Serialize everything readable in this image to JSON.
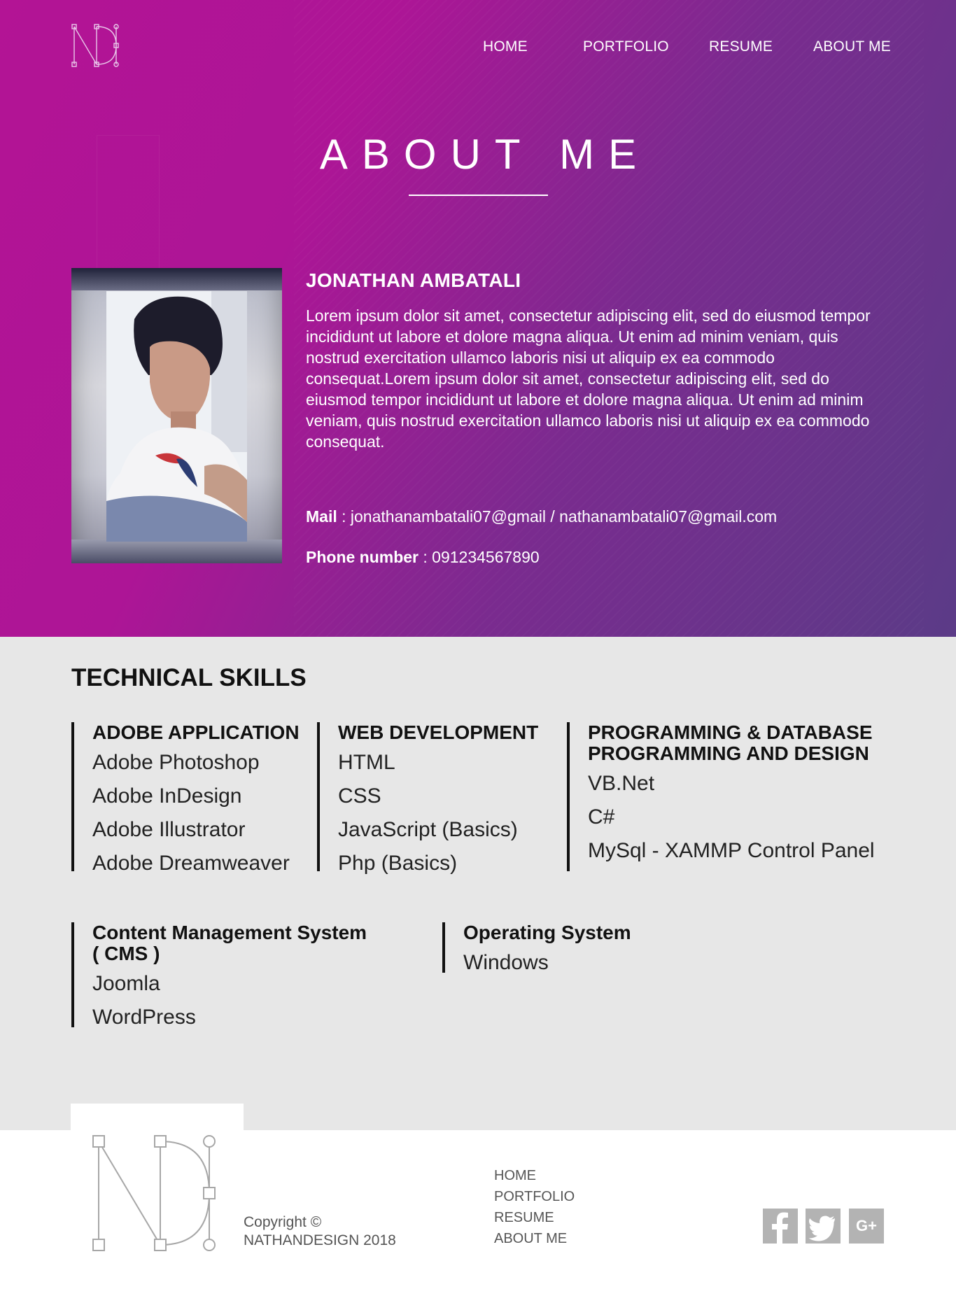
{
  "nav": {
    "items": [
      "HOME",
      "PORTFOLIO",
      "RESUME",
      "ABOUT ME"
    ]
  },
  "hero": {
    "title": "ABOUT ME",
    "name": "JONATHAN AMBATALI",
    "bio": "Lorem ipsum dolor sit amet, consectetur adipiscing elit, sed do eiusmod tempor incididunt ut labore et dolore magna aliqua. Ut enim ad minim veniam, quis nostrud exercitation ullamco laboris nisi ut aliquip ex ea commodo consequat.Lorem ipsum dolor sit amet, consectetur adipiscing elit, sed do eiusmod tempor incididunt ut labore et dolore magna aliqua. Ut enim ad minim veniam, quis nostrud exercitation ullamco laboris nisi ut aliquip ex ea commodo consequat.",
    "mail_label": "Mail",
    "mail_value": " : jonathanambatali07@gmail / nathanambatali07@gmail.com",
    "phone_label": "Phone number",
    "phone_value": " : 091234567890"
  },
  "skills": {
    "title": "TECHNICAL SKILLS",
    "groups": [
      {
        "heading_lines": [
          "ADOBE APPLICATION"
        ],
        "items": [
          "Adobe Photoshop",
          "Adobe InDesign",
          "Adobe Illustrator",
          "Adobe Dreamweaver"
        ]
      },
      {
        "heading_lines": [
          "WEB DEVELOPMENT"
        ],
        "items": [
          "HTML",
          "CSS",
          "JavaScript (Basics)",
          "Php (Basics)"
        ]
      },
      {
        "heading_lines": [
          "PROGRAMMING & DATABASE",
          "PROGRAMMING AND DESIGN"
        ],
        "items": [
          "VB.Net",
          "C#",
          "MySql - XAMMP Control Panel"
        ]
      },
      {
        "heading_lines": [
          "Content Management System",
          "( CMS )"
        ],
        "items": [
          "Joomla",
          "WordPress"
        ]
      },
      {
        "heading_lines": [
          "Operating System"
        ],
        "items": [
          "Windows"
        ]
      }
    ]
  },
  "footer": {
    "copyright_line1": "Copyright ©",
    "copyright_line2": "NATHANDESIGN 2018",
    "nav": [
      "HOME",
      "PORTFOLIO",
      "RESUME",
      "ABOUT ME"
    ],
    "social": [
      "facebook-icon",
      "twitter-icon",
      "google-plus-icon"
    ],
    "google_plus_text": "G+"
  },
  "colors": {
    "hero_gradient_start": "#b31495",
    "hero_gradient_end": "#5b3b87",
    "skills_background": "#e7e7e7",
    "social_icon_bg": "#b3b3b3"
  }
}
